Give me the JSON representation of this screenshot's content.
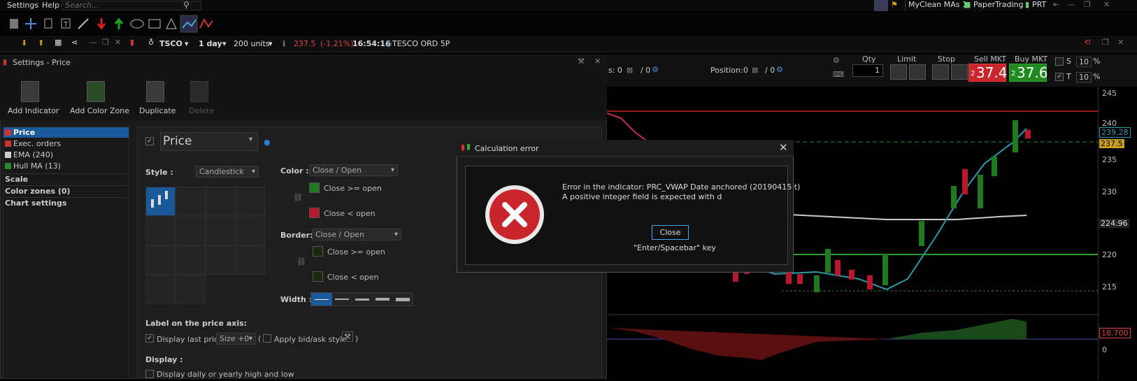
{
  "menu": {
    "settings": "Settings",
    "help": "Help",
    "search_placeholder": "Search..."
  },
  "top_right": {
    "myclean": "MyClean MAs 1",
    "paper": "PaperTrading",
    "prt": "PRT"
  },
  "chart_bar": {
    "symbol": "TSCO",
    "timeframe": "1 day",
    "units": "200 units",
    "price": "237.5",
    "change": "(-1.21%)",
    "time": "16:54:16",
    "instrument": "TESCO ORD 5P"
  },
  "settings_panel": {
    "title": "Settings - Price",
    "tools": {
      "add_indicator": "Add Indicator",
      "add_color_zone": "Add Color Zone",
      "duplicate": "Duplicate",
      "delete": "Delete"
    },
    "list": [
      {
        "label": "Price",
        "color": "#2a7fd4"
      },
      {
        "label": "Exec. orders",
        "color": "#c83030"
      },
      {
        "label": "EMA (240)",
        "color": "#cccccc"
      },
      {
        "label": "Hull MA (13)",
        "color": "#2a8a2a"
      }
    ],
    "sections": {
      "scale": "Scale",
      "color_zones": "Color zones (0)",
      "chart_settings": "Chart settings"
    },
    "price_name": "Price",
    "style_label": "Style :",
    "style_value": "Candlestick",
    "color_label": "Color :",
    "color_value": "Close / Open",
    "close_ge_open": "Close >= open",
    "close_lt_open": "Close < open",
    "border_label": "Border:",
    "border_value": "Close / Open",
    "border_ge": "Close >= open",
    "border_lt": "Close < open",
    "width_label": "Width :",
    "label_axis": "Label on the price axis:",
    "display_last_price": "Display last price",
    "size_value": "Size +0",
    "paren_open": "(",
    "apply_bidask": "Apply bid/ask style",
    "paren_close": ")",
    "display_label": "Display :",
    "display_daily": "Display daily or yearly high and low",
    "colors": {
      "up": "#1f7a1f",
      "down": "#b8172e"
    }
  },
  "trade_panel": {
    "qty_label": "Qty",
    "qty_value": "1",
    "limit_label": "Limit",
    "stop_label": "Stop",
    "sell_label": "Sell MKT",
    "sell_small": "2",
    "sell_price": "37.4",
    "buy_label": "Buy MKT",
    "buy_small": "2",
    "buy_price": "37.6",
    "s_label": "S",
    "t_label": "T",
    "pct1": "10",
    "pct2": "10",
    "pct_sign": "%"
  },
  "position_bar": {
    "orders_prefix": "s: 0",
    "orders_slash": "/ 0",
    "position_label": "Position:",
    "position_value": "0",
    "position_slash": "/ 0"
  },
  "price_axis": {
    "ticks": [
      "245",
      "240",
      "235",
      "230",
      "225",
      "220",
      "215"
    ],
    "current": "237.5",
    "ma_value": "239.28",
    "ema_value": "224.96",
    "osc_value": "18.700",
    "osc_zero": "0"
  },
  "dialog": {
    "title": "Calculation error",
    "line1": "Error in the indicator: PRC_VWAP Date anchored (20190415 t)",
    "line2": "A positive integer field is expected with d",
    "close_button": "Close",
    "key_hint": "\"Enter/Spacebar\" key"
  }
}
